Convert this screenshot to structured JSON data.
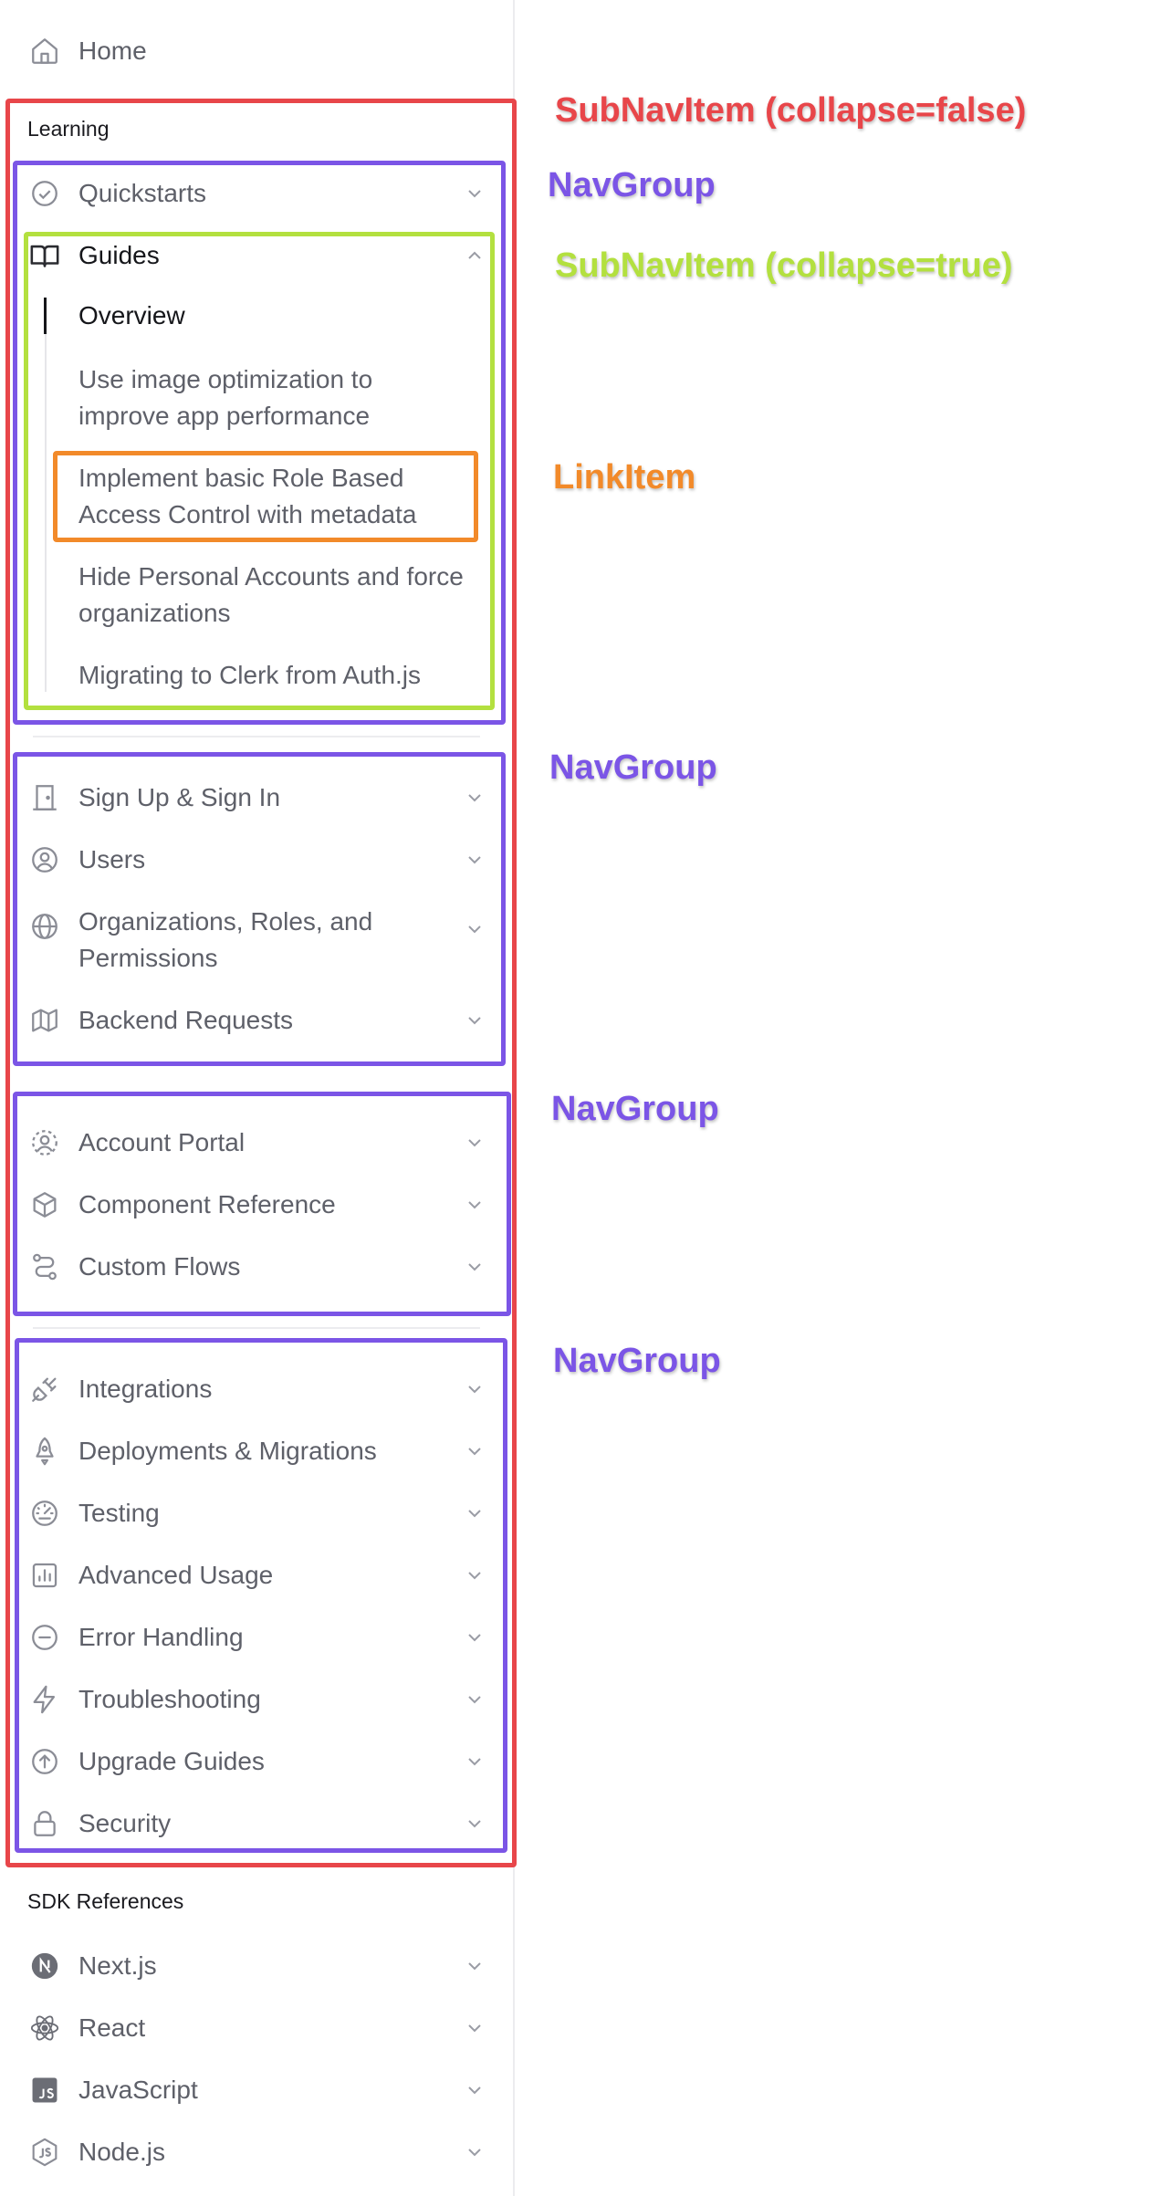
{
  "home": {
    "label": "Home",
    "icon": "home-icon"
  },
  "learning": {
    "title": "Learning",
    "group1": [
      {
        "label": "Quickstarts",
        "icon": "check-circle-icon"
      }
    ],
    "guides": {
      "label": "Guides",
      "icon": "book-open-icon",
      "links": [
        {
          "label": "Overview",
          "active": true
        },
        {
          "label": "Use image optimization to improve app performance",
          "line1": "Use image optimization to",
          "line2": "improve app performance"
        },
        {
          "label": "Implement basic Role Based Access Control with metadata",
          "line1": "Implement basic Role Based",
          "line2": "Access Control with metadata"
        },
        {
          "label": "Hide Personal Accounts and force organizations",
          "line1": "Hide Personal Accounts and force",
          "line2": "organizations"
        },
        {
          "label": "Migrating to Clerk from Auth.js"
        }
      ]
    },
    "group2": [
      {
        "label": "Sign Up & Sign In",
        "icon": "door-icon"
      },
      {
        "label": "Users",
        "icon": "user-circle-icon"
      },
      {
        "label": "Organizations, Roles, and Permissions",
        "line1": "Organizations, Roles, and",
        "line2": "Permissions",
        "icon": "globe-icon"
      },
      {
        "label": "Backend Requests",
        "icon": "map-icon"
      }
    ],
    "group3": [
      {
        "label": "Account Portal",
        "icon": "user-dashed-icon"
      },
      {
        "label": "Component Reference",
        "icon": "cube-icon"
      },
      {
        "label": "Custom Flows",
        "icon": "flow-icon"
      }
    ],
    "group4": [
      {
        "label": "Integrations",
        "icon": "plug-icon"
      },
      {
        "label": "Deployments & Migrations",
        "icon": "rocket-icon"
      },
      {
        "label": "Testing",
        "icon": "gauge-icon"
      },
      {
        "label": "Advanced Usage",
        "icon": "bar-chart-icon"
      },
      {
        "label": "Error Handling",
        "icon": "minus-circle-icon"
      },
      {
        "label": "Troubleshooting",
        "icon": "bolt-icon"
      },
      {
        "label": "Upgrade Guides",
        "icon": "arrow-up-circle-icon"
      },
      {
        "label": "Security",
        "icon": "lock-icon"
      }
    ]
  },
  "sdk": {
    "title": "SDK References",
    "items": [
      {
        "label": "Next.js",
        "icon": "nextjs-icon"
      },
      {
        "label": "React",
        "icon": "react-icon"
      },
      {
        "label": "JavaScript",
        "icon": "javascript-icon"
      },
      {
        "label": "Node.js",
        "icon": "nodejs-icon"
      }
    ]
  },
  "annotations": {
    "subnav_false": "SubNavItem (collapse=false)",
    "navgroup1": "NavGroup",
    "subnav_true": "SubNavItem (collapse=true)",
    "linkitem": "LinkItem",
    "navgroup2": "NavGroup",
    "navgroup3": "NavGroup",
    "navgroup4": "NavGroup"
  },
  "colors": {
    "subnav_false": "#e8464a",
    "navgroup": "#7b55e6",
    "subnav_true": "#b3e03f",
    "linkitem": "#f28a2a",
    "text": "#5e6069",
    "text_active": "#15161a"
  }
}
